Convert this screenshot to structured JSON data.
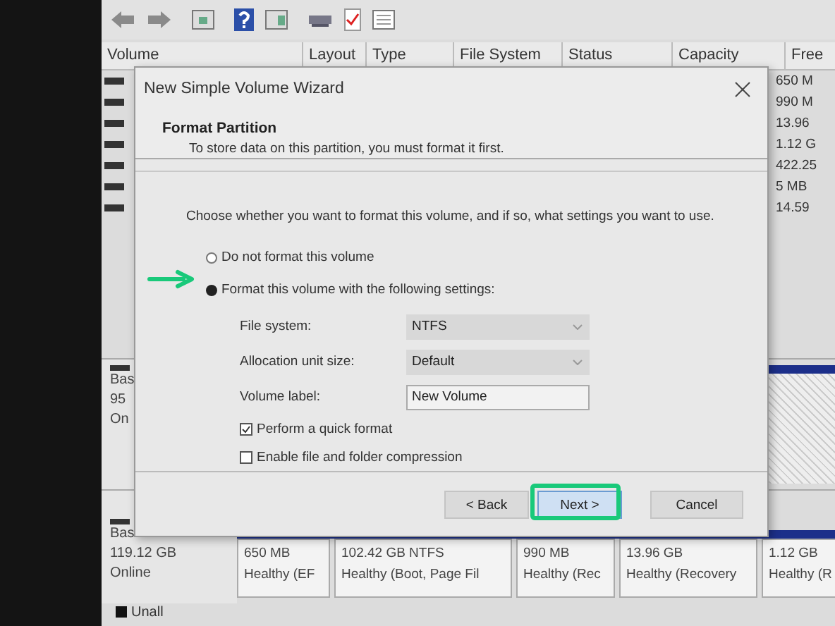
{
  "volume_table": {
    "columns": [
      "Volume",
      "Layout",
      "Type",
      "File System",
      "Status",
      "Capacity",
      "Free"
    ],
    "rows": [
      {
        "free_space": "650 M"
      },
      {
        "free_space": "990 M"
      },
      {
        "free_space": "13.96"
      },
      {
        "free_space": "1.12 G"
      },
      {
        "free_space": "422.25"
      },
      {
        "free_space": "5 MB"
      },
      {
        "free_space": "14.59"
      }
    ]
  },
  "disks": [
    {
      "lines": [
        "Bas",
        "95",
        "On"
      ]
    },
    {
      "lines": [
        "Bas",
        "119.12 GB",
        "Online"
      ],
      "partitions": [
        {
          "size": "650 MB",
          "status": "Healthy (EF"
        },
        {
          "size": "102.42 GB NTFS",
          "status": "Healthy (Boot, Page Fil"
        },
        {
          "size": "990 MB",
          "status": "Healthy (Rec"
        },
        {
          "size": "13.96 GB",
          "status": "Healthy (Recovery"
        },
        {
          "size": "1.12 GB",
          "status": "Healthy (R"
        }
      ]
    }
  ],
  "legend": [
    "Unall"
  ],
  "dialog": {
    "title": "New Simple Volume Wizard",
    "heading": "Format Partition",
    "subheading": "To store data on this partition, you must format it first.",
    "instruction": "Choose whether you want to format this volume, and if so, what settings you want to use.",
    "options": [
      {
        "label": "Do not format this volume",
        "selected": false
      },
      {
        "label": "Format this volume with the following settings:",
        "selected": true
      }
    ],
    "settings": [
      {
        "kind": "dropdown",
        "label": "File system:",
        "value": "NTFS"
      },
      {
        "kind": "dropdown",
        "label": "Allocation unit size:",
        "value": "Default"
      },
      {
        "kind": "text",
        "label": "Volume label:",
        "value": "New Volume"
      }
    ],
    "checkboxes": [
      {
        "label": "Perform a quick format",
        "checked": true
      },
      {
        "label": "Enable file and folder compression",
        "checked": false
      }
    ],
    "buttons": [
      {
        "label": "< Back",
        "default": false
      },
      {
        "label": "Next >",
        "default": true
      },
      {
        "label": "Cancel",
        "default": false
      }
    ]
  }
}
